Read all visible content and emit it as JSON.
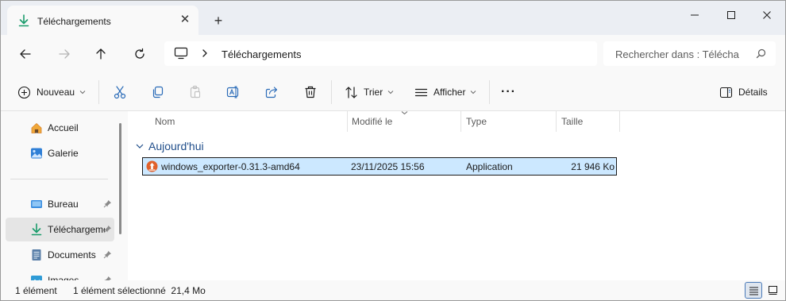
{
  "tab": {
    "title": "Téléchargements",
    "icon": "download-icon"
  },
  "window": {
    "minimize_icon": "minimize-icon",
    "maximize_icon": "maximize-icon",
    "close_icon": "close-icon",
    "new_tab_label": "+"
  },
  "nav": {
    "breadcrumb": "Téléchargements",
    "search_placeholder": "Rechercher dans : Télécha"
  },
  "toolbar": {
    "new_label": "Nouveau",
    "sort_label": "Trier",
    "view_label": "Afficher",
    "more_label": "···",
    "details_label": "Détails"
  },
  "sidebar": {
    "items": [
      {
        "label": "Accueil",
        "icon": "home-icon"
      },
      {
        "label": "Galerie",
        "icon": "gallery-icon"
      },
      {
        "label": "Bureau",
        "icon": "desktop-icon"
      },
      {
        "label": "Téléchargements",
        "icon": "download-icon"
      },
      {
        "label": "Documents",
        "icon": "documents-icon"
      },
      {
        "label": "Images",
        "icon": "images-icon"
      }
    ]
  },
  "columns": [
    "Nom",
    "Modifié le",
    "Type",
    "Taille"
  ],
  "group": {
    "label": "Aujourd'hui"
  },
  "files": [
    {
      "name": "windows_exporter-0.31.3-amd64",
      "modified": "23/11/2025 15:56",
      "type": "Application",
      "size": "21 946 Ko"
    }
  ],
  "status": {
    "count": "1 élément",
    "selected": "1 élément sélectionné  21,4 Mo"
  },
  "colors": {
    "accent": "#0078d4",
    "selection": "#cce8ff",
    "group_text": "#1f4d8a",
    "download_green": "#1a9c6b"
  }
}
